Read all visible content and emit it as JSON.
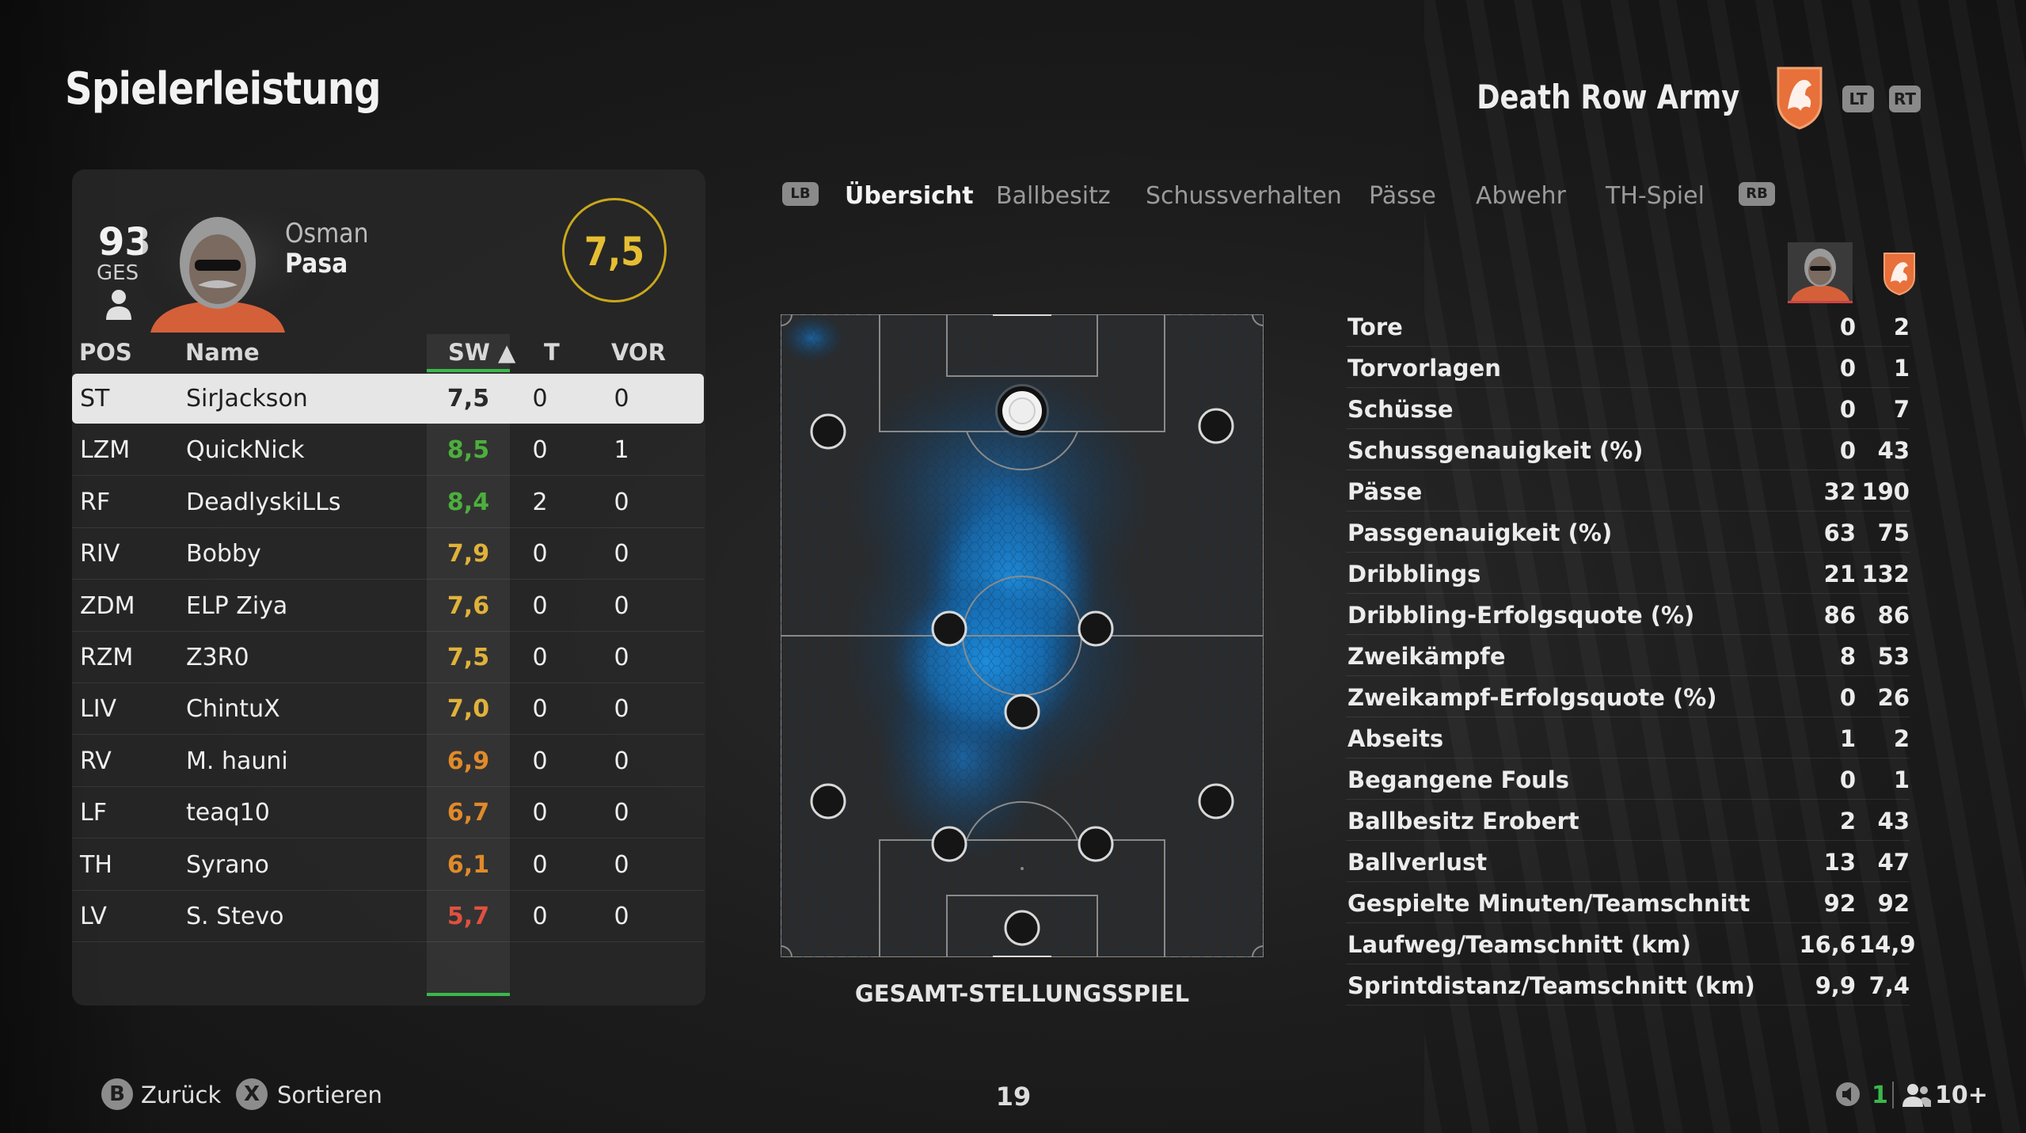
{
  "header": {
    "title": "Spielerleistung",
    "team_name": "Death Row Army",
    "lt_label": "LT",
    "rt_label": "RT"
  },
  "player_card": {
    "overall": "93",
    "overall_label": "GES",
    "first_name": "Osman",
    "last_name": "Pasa",
    "rating": "7,5"
  },
  "table": {
    "headers": {
      "pos": "POS",
      "name": "Name",
      "sw": "SW ▲",
      "t": "T",
      "vor": "VOR"
    },
    "rows": [
      {
        "pos": "ST",
        "name": "SirJackson",
        "sw": "7,5",
        "t": "0",
        "vor": "0",
        "sw_color": "#2a2a2a"
      },
      {
        "pos": "LZM",
        "name": "QuickNick",
        "sw": "8,5",
        "t": "0",
        "vor": "1",
        "sw_color": "#4caf3c"
      },
      {
        "pos": "RF",
        "name": "DeadlyskiLLs",
        "sw": "8,4",
        "t": "2",
        "vor": "0",
        "sw_color": "#4caf3c"
      },
      {
        "pos": "RIV",
        "name": "Bobby",
        "sw": "7,9",
        "t": "0",
        "vor": "0",
        "sw_color": "#e0b23a"
      },
      {
        "pos": "ZDM",
        "name": "ELP Ziya",
        "sw": "7,6",
        "t": "0",
        "vor": "0",
        "sw_color": "#e0b23a"
      },
      {
        "pos": "RZM",
        "name": "Z3R0",
        "sw": "7,5",
        "t": "0",
        "vor": "0",
        "sw_color": "#e0b23a"
      },
      {
        "pos": "LIV",
        "name": "ChintuX",
        "sw": "7,0",
        "t": "0",
        "vor": "0",
        "sw_color": "#e0b23a"
      },
      {
        "pos": "RV",
        "name": "M. hauni",
        "sw": "6,9",
        "t": "0",
        "vor": "0",
        "sw_color": "#e08a2a"
      },
      {
        "pos": "LF",
        "name": "teaq10",
        "sw": "6,7",
        "t": "0",
        "vor": "0",
        "sw_color": "#e08a2a"
      },
      {
        "pos": "TH",
        "name": "Syrano",
        "sw": "6,1",
        "t": "0",
        "vor": "0",
        "sw_color": "#e08a2a"
      },
      {
        "pos": "LV",
        "name": "S. Stevo",
        "sw": "5,7",
        "t": "0",
        "vor": "0",
        "sw_color": "#e05040"
      }
    ]
  },
  "tabs": {
    "lb": "LB",
    "rb": "RB",
    "items": [
      "Übersicht",
      "Ballbesitz",
      "Schussverhalten",
      "Pässe",
      "Abwehr",
      "TH-Spiel"
    ],
    "active": "Übersicht"
  },
  "pitch": {
    "caption": "GESAMT-STELLUNGSSPIEL"
  },
  "stats": [
    {
      "label": "Tore",
      "player": "0",
      "team": "2"
    },
    {
      "label": "Torvorlagen",
      "player": "0",
      "team": "1"
    },
    {
      "label": "Schüsse",
      "player": "0",
      "team": "7"
    },
    {
      "label": "Schussgenauigkeit (%)",
      "player": "0",
      "team": "43"
    },
    {
      "label": "Pässe",
      "player": "32",
      "team": "190"
    },
    {
      "label": "Passgenauigkeit (%)",
      "player": "63",
      "team": "75"
    },
    {
      "label": "Dribblings",
      "player": "21",
      "team": "132"
    },
    {
      "label": "Dribbling-Erfolgsquote (%)",
      "player": "86",
      "team": "86"
    },
    {
      "label": "Zweikämpfe",
      "player": "8",
      "team": "53"
    },
    {
      "label": "Zweikampf-Erfolgsquote (%)",
      "player": "0",
      "team": "26"
    },
    {
      "label": "Abseits",
      "player": "1",
      "team": "2"
    },
    {
      "label": "Begangene Fouls",
      "player": "0",
      "team": "1"
    },
    {
      "label": "Ballbesitz Erobert",
      "player": "2",
      "team": "43"
    },
    {
      "label": "Ballverlust",
      "player": "13",
      "team": "47"
    },
    {
      "label": "Gespielte Minuten/Teamschnitt",
      "player": "92",
      "team": "92"
    },
    {
      "label": "Laufweg/Teamschnitt (km)",
      "player": "16,6",
      "team": "14,9"
    },
    {
      "label": "Sprintdistanz/Teamschnitt (km)",
      "player": "9,9",
      "team": "7,4"
    }
  ],
  "footer": {
    "back_key": "B",
    "back_label": "Zurück",
    "sort_key": "X",
    "sort_label": "Sortieren",
    "page_number": "19",
    "count_green": "1",
    "count_party": "10+"
  },
  "colors": {
    "accent_green": "#3bb84a",
    "rating_ring": "#c9a81c",
    "crest_orange": "#e8703a"
  }
}
